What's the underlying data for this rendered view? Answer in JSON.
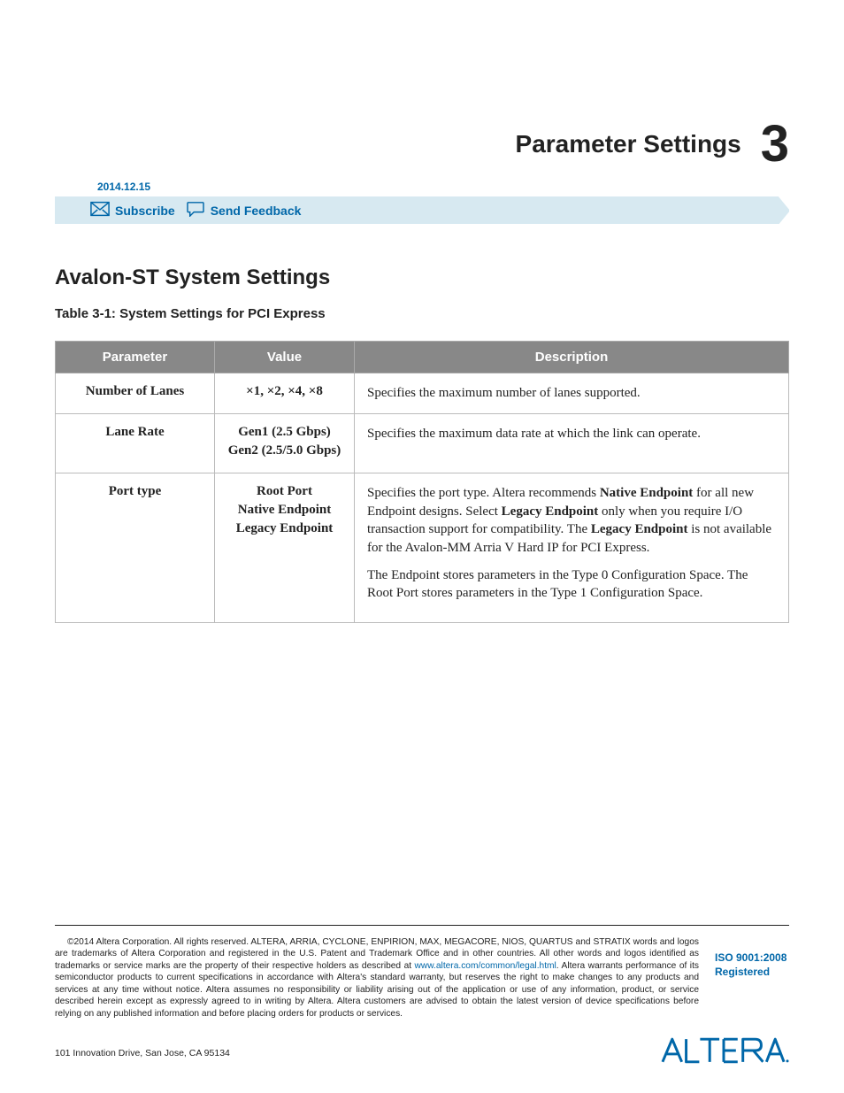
{
  "chapter": {
    "title": "Parameter Settings",
    "number": "3"
  },
  "header_bar": {
    "date": "2014.12.15",
    "subscribe": "Subscribe",
    "send_feedback": "Send Feedback"
  },
  "section_title": "Avalon-ST System Settings",
  "table_caption": "Table 3-1: System Settings for PCI Express",
  "table": {
    "headers": {
      "parameter": "Parameter",
      "value": "Value",
      "description": "Description"
    },
    "rows": [
      {
        "parameter": "Number of Lanes",
        "value_lines": [
          "×1, ×2, ×4, ×8"
        ],
        "description_html": "Specifies the maximum number of lanes supported."
      },
      {
        "parameter": "Lane Rate",
        "value_lines": [
          "Gen1 (2.5 Gbps)",
          "Gen2 (2.5/5.0 Gbps)"
        ],
        "description_html": "Specifies the maximum data rate at which the link can operate."
      },
      {
        "parameter": "Port type",
        "value_lines": [
          "Root Port",
          "Native Endpoint",
          "Legacy Endpoint"
        ],
        "description_html": "Specifies the port type. Altera recommends <b>Native Endpoint</b> for all new Endpoint designs. Select <b>Legacy Endpoint</b> only when you require I/O transaction support for compatibility. The <b>Legacy Endpoint</b> is not available for the Avalon‑MM Arria V Hard IP for PCI Express.<p>The Endpoint stores parameters in the Type 0 Configuration Space. The Root Port stores parameters in the Type 1 Configu­ration Space.</p>"
      }
    ]
  },
  "footer": {
    "copyright_pre": "2014 Altera Corporation. All rights reserved. ALTERA, ARRIA, CYCLONE, ENPIRION, MAX, MEGACORE, NIOS, QUARTUS and STRATIX words and logos are trademarks of Altera Corporation and registered in the U.S. Patent and Trademark Office and in other countries. All other words and logos identified as trademarks or service marks are the property of their respective holders as described at ",
    "legal_url": "www.altera.com/common/legal.html",
    "copyright_post": ". Altera warrants performance of its semiconductor products to current specifications in accordance with Altera's standard warranty, but reserves the right to make changes to any products and services at any time without notice. Altera assumes no responsibility or liability arising out of the application or use of any information, product, or service described herein except as expressly agreed to in writing by Altera. Altera customers are advised to obtain the latest version of device specifications before relying on any published information and before placing orders for products or services.",
    "iso": "ISO 9001:2008 Registered",
    "address": "101 Innovation Drive, San Jose, CA 95134",
    "copyright_symbol": "©",
    "logo_name": "ALTERA"
  }
}
